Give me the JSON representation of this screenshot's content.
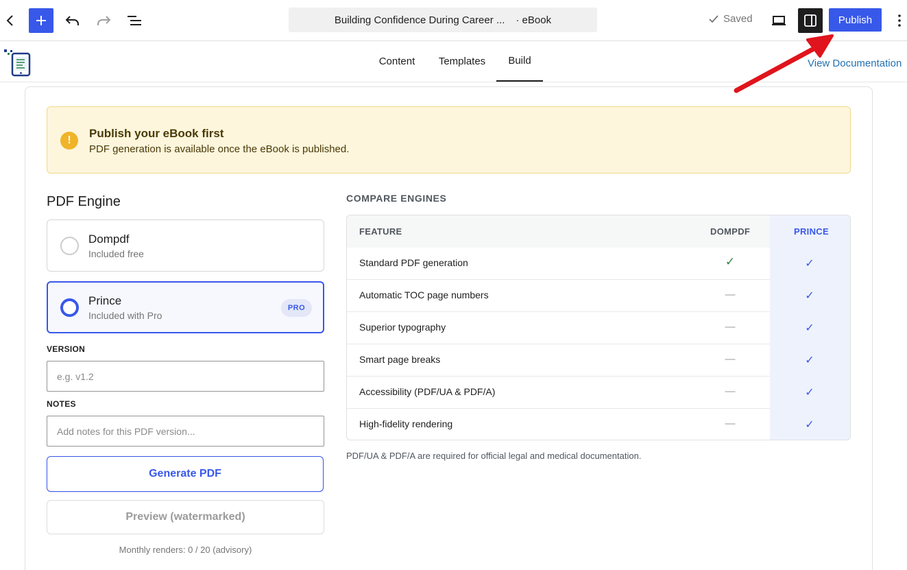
{
  "toolbar": {
    "document_title": "Building Confidence During Career ...",
    "post_type": "· eBook",
    "saved_label": "Saved",
    "publish_label": "Publish"
  },
  "tabs": [
    {
      "label": "Content"
    },
    {
      "label": "Templates"
    },
    {
      "label": "Build"
    }
  ],
  "view_documentation": "View Documentation",
  "notice": {
    "title": "Publish your eBook first",
    "text": "PDF generation is available once the eBook is published."
  },
  "pdf_engine": {
    "heading": "PDF Engine",
    "options": [
      {
        "name": "Dompdf",
        "subtitle": "Included free",
        "selected": false
      },
      {
        "name": "Prince",
        "subtitle": "Included with Pro",
        "selected": true,
        "badge": "PRO"
      }
    ]
  },
  "form": {
    "version_label": "VERSION",
    "version_placeholder": "e.g. v1.2",
    "version_value": "",
    "notes_label": "NOTES",
    "notes_placeholder": "Add notes for this PDF version...",
    "notes_value": "",
    "generate_label": "Generate PDF",
    "preview_label": "Preview (watermarked)",
    "renders_text": "Monthly renders: 0 / 20 (advisory)"
  },
  "compare": {
    "heading": "COMPARE ENGINES",
    "columns": [
      "FEATURE",
      "DOMPDF",
      "PRINCE"
    ],
    "rows": [
      {
        "feature": "Standard PDF generation",
        "dompdf": "✓",
        "prince": "✓"
      },
      {
        "feature": "Automatic TOC page numbers",
        "dompdf": "—",
        "prince": "✓"
      },
      {
        "feature": "Superior typography",
        "dompdf": "—",
        "prince": "✓"
      },
      {
        "feature": "Smart page breaks",
        "dompdf": "—",
        "prince": "✓"
      },
      {
        "feature": "Accessibility (PDF/UA & PDF/A)",
        "dompdf": "—",
        "prince": "✓"
      },
      {
        "feature": "High-fidelity rendering",
        "dompdf": "—",
        "prince": "✓"
      }
    ],
    "footnote": "PDF/UA & PDF/A are required for official legal and medical documentation."
  },
  "colors": {
    "accent": "#3858e9",
    "notice_bg": "#fdf6dd",
    "notice_icon": "#f0b429",
    "check_green": "#2e8540",
    "annotation_arrow": "#e0141c"
  }
}
